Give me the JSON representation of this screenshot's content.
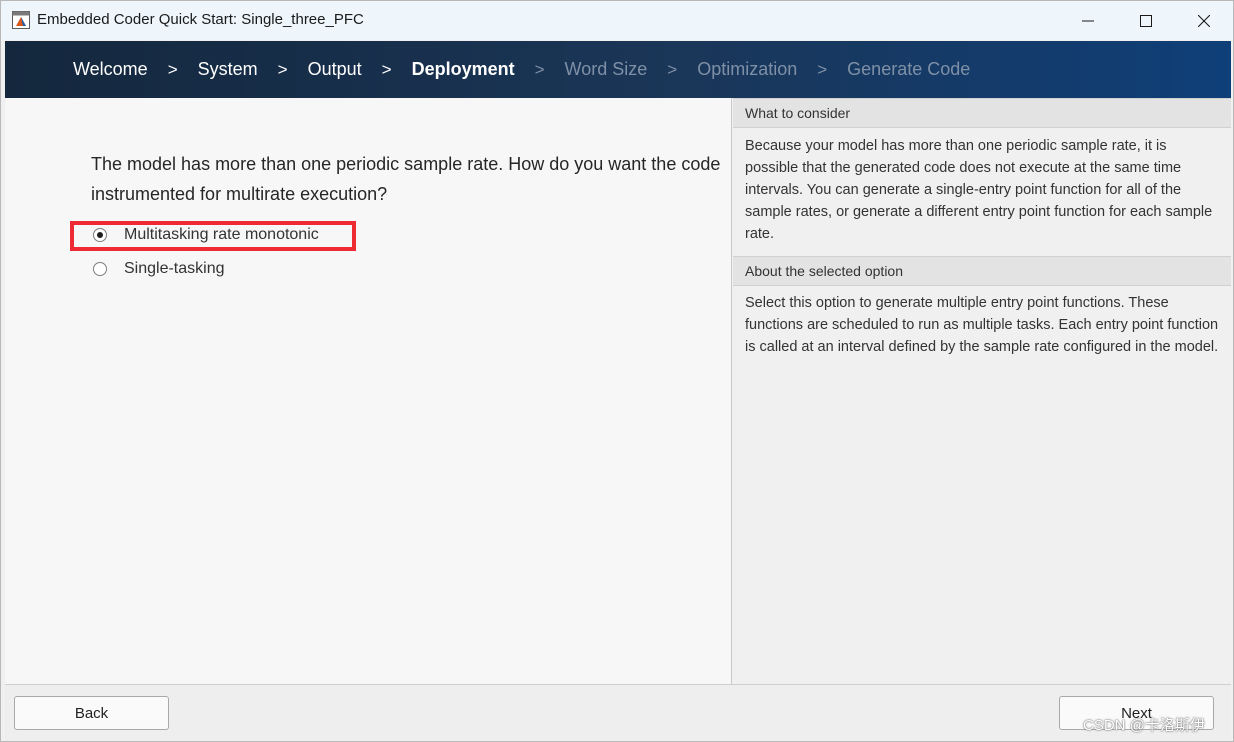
{
  "window": {
    "title": "Embedded Coder Quick Start: Single_three_PFC"
  },
  "steps": [
    {
      "label": "Welcome",
      "state": "done"
    },
    {
      "label": "System",
      "state": "done"
    },
    {
      "label": "Output",
      "state": "done"
    },
    {
      "label": "Deployment",
      "state": "active"
    },
    {
      "label": "Word Size",
      "state": "future"
    },
    {
      "label": "Optimization",
      "state": "future"
    },
    {
      "label": "Generate Code",
      "state": "future"
    }
  ],
  "step_separator": ">",
  "main": {
    "question": "The model has more than one periodic sample rate. How do you want the code instrumented for multirate execution?",
    "options": [
      {
        "label": "Multitasking rate monotonic",
        "selected": true
      },
      {
        "label": "Single-tasking",
        "selected": false
      }
    ]
  },
  "info": {
    "consider_header": "What to consider",
    "consider_body": "Because your model has more than one periodic sample rate, it is possible that the generated code does not execute at the same time intervals. You can generate a single-entry point function for all of the sample rates, or generate a different entry point function for each sample rate.",
    "option_header": "About the selected option",
    "option_body": "Select this option to generate multiple entry point functions. These functions are scheduled to run as multiple tasks. Each entry point function is called at an interval defined by the sample rate configured in the model."
  },
  "buttons": {
    "back": "Back",
    "next": "Next"
  },
  "watermark": "CSDN @卡洛斯伊",
  "colors": {
    "banner_dark": "#14273d",
    "banner_light": "#0f3f78",
    "step_future": "#7f90a6",
    "highlight": "#ee2a32"
  },
  "icons": {
    "app": "matlab-app-icon",
    "minimize": "minimize-icon",
    "maximize": "maximize-icon",
    "close": "close-icon"
  }
}
